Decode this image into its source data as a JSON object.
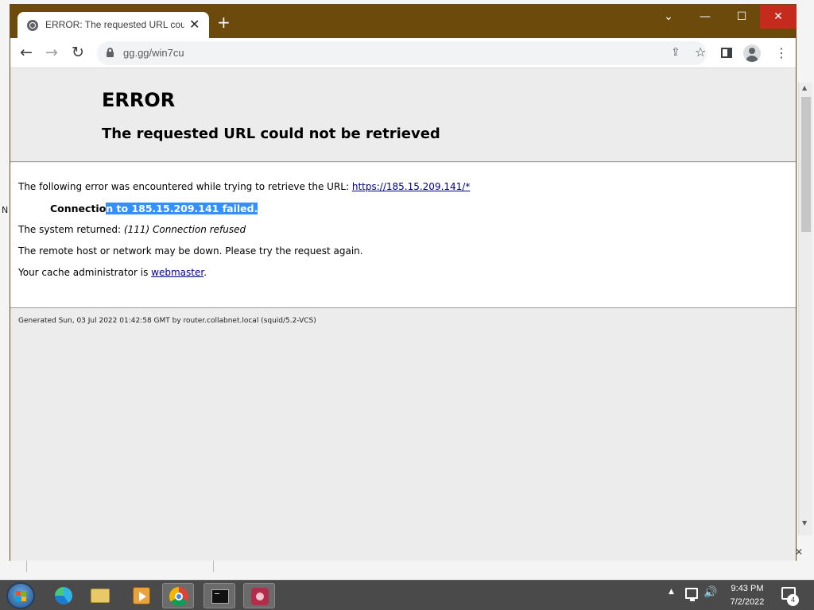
{
  "browser": {
    "tab_title": "ERROR: The requested URL could not be retrieved",
    "tab_close": "✕",
    "new_tab": "+",
    "window_controls": {
      "chevron": "⌄",
      "minimize": "—",
      "maximize": "☐",
      "close": "✕"
    },
    "url": "gg.gg/win7cu",
    "nav": {
      "back": "←",
      "forward": "→",
      "reload": "↻"
    },
    "menu": "⋮"
  },
  "page": {
    "title": "ERROR",
    "subtitle": "The requested URL could not be retrieved",
    "line1_text": "The following error was encountered while trying to retrieve the URL: ",
    "line1_link": "https://185.15.209.141/*",
    "line2_unselected": "Connectio",
    "line2_selected": "n to 185.15.209.141 failed.",
    "line3_prefix": "The system returned: ",
    "line3_detail": "(111) Connection refused",
    "line4": "The remote host or network may be down. Please try the request again.",
    "line5_prefix": "Your cache administrator is ",
    "line5_link": "webmaster",
    "line5_suffix": ".",
    "footer": "Generated Sun, 03 Jul 2022 01:42:58 GMT by router.collabnet.local (squid/5.2-VCS)"
  },
  "taskbar": {
    "apps": [
      "start",
      "edge",
      "file-explorer",
      "media-player",
      "chrome",
      "command-prompt",
      "paint"
    ],
    "clock_time": "9:43 PM",
    "clock_date": "7/2/2022",
    "notification_count": "4"
  },
  "colors": {
    "titlebar": "#6b4a0c",
    "close_button": "#c42b1c",
    "selection": "#3390ff",
    "link": "#00008b",
    "taskbar": "#4a4a4a"
  },
  "icons": {
    "tab": "globe-icon",
    "lock": "lock-icon",
    "share": "share-icon",
    "star": "star-icon",
    "side_panel": "side-panel-icon",
    "profile": "profile-icon",
    "menu": "menu-icon"
  }
}
